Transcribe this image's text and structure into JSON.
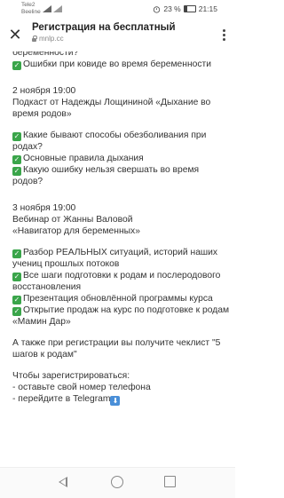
{
  "status_bar": {
    "carrier_1": "Tele2",
    "carrier_2": "Beeline",
    "battery": "23 %",
    "time": "21:15"
  },
  "header": {
    "title": "Регистрация на бесплатный",
    "url": "mnlp.cc"
  },
  "content": {
    "top_lines": [
      "беременности?",
      "Ошибки при ковиде во время беременности"
    ],
    "event_2": {
      "date": "2 ноября 19:00",
      "title": "Подкаст от Надежды Лощининой «Дыхание во время родов»",
      "items": [
        "Какие бывают способы обезболивания при родах?",
        "Основные правила дыхания",
        "Какую ошибку нельзя свершать во время родов?"
      ]
    },
    "event_3": {
      "date": "3 ноября 19:00",
      "line1": "Вебинар от Жанны Валовой",
      "line2": "«Навигатор для беременных»",
      "items": [
        "Разбор РЕАЛЬНЫХ ситуаций, историй наших учениц прошлых потоков",
        "Все шаги подготовки к родам и послеродового восстановления",
        "Презентация обновлённой программы курса",
        "Открытие продаж на курс по подготовке к родам «Мамин Дар»"
      ]
    },
    "bonus": "А также при регистрации вы получите чеклист \"5 шагов к родам\"",
    "register_title": "Чтобы зарегистрироваться:",
    "steps": [
      "- оставьте свой номер телефона",
      "- перейдите в Telegram"
    ]
  },
  "icons": {
    "check": "check-mark-button-icon",
    "down": "down-arrow-button-icon",
    "check_color": "#3aa54a",
    "down_color": "#4a8fd8"
  }
}
